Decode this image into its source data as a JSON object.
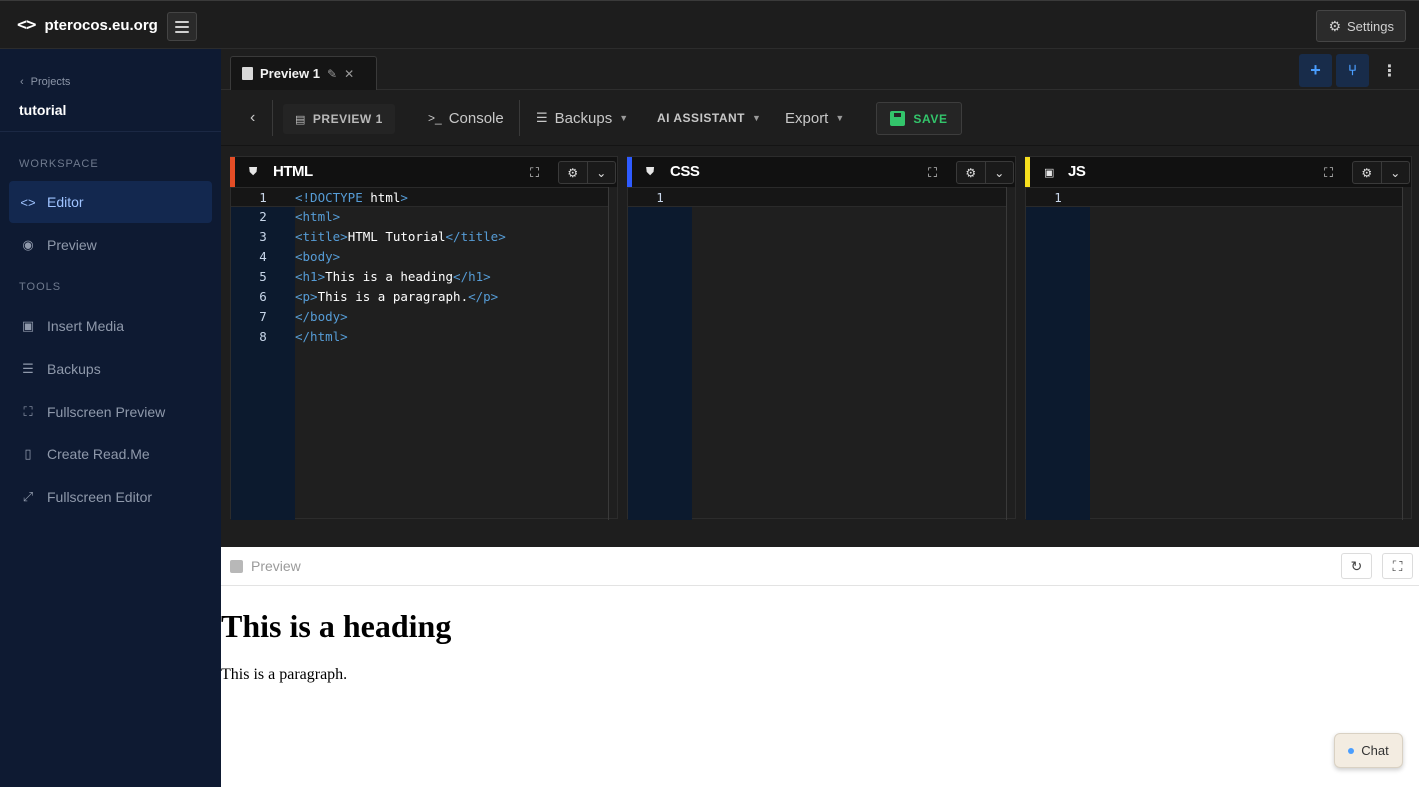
{
  "brand": {
    "name": "pterocos.eu.org",
    "icon": "code-icon"
  },
  "header": {
    "settings_label": "Settings"
  },
  "sidebar": {
    "breadcrumb": "Projects",
    "project_name": "tutorial",
    "sections": {
      "workspace": "WORKSPACE",
      "tools": "TOOLS"
    },
    "workspace_items": [
      {
        "label": "Editor",
        "icon": "code-icon",
        "active": true
      },
      {
        "label": "Preview",
        "icon": "eye-icon",
        "active": false
      }
    ],
    "tool_items": [
      {
        "label": "Insert Media",
        "icon": "image-icon"
      },
      {
        "label": "Backups",
        "icon": "database-icon"
      },
      {
        "label": "Fullscreen Preview",
        "icon": "fullscreen-icon"
      },
      {
        "label": "Create Read.Me",
        "icon": "book-icon"
      },
      {
        "label": "Fullscreen Editor",
        "icon": "expand-icon"
      }
    ]
  },
  "tabs": [
    {
      "label": "Preview 1",
      "active": true
    }
  ],
  "toolbar": {
    "preview_label": "PREVIEW 1",
    "console_label": "Console",
    "backups_label": "Backups",
    "ai_label": "AI ASSISTANT",
    "export_label": "Export",
    "save_label": "SAVE"
  },
  "panels": [
    {
      "title": "HTML",
      "accent": "#e44d26",
      "lines": [
        {
          "n": "1",
          "parts": [
            [
              "tag",
              "<!DOCTYPE "
            ],
            [
              "tx",
              "html"
            ],
            [
              "tag",
              ">"
            ]
          ]
        },
        {
          "n": "2",
          "parts": [
            [
              "tag",
              "<html>"
            ]
          ]
        },
        {
          "n": "3",
          "parts": [
            [
              "tag",
              "<title>"
            ],
            [
              "tx",
              "HTML Tutorial"
            ],
            [
              "tag",
              "</title>"
            ]
          ]
        },
        {
          "n": "4",
          "parts": [
            [
              "tag",
              "<body>"
            ]
          ]
        },
        {
          "n": "5",
          "parts": [
            [
              "tag",
              "<h1>"
            ],
            [
              "tx",
              "This is a heading"
            ],
            [
              "tag",
              "</h1>"
            ]
          ]
        },
        {
          "n": "6",
          "parts": [
            [
              "tag",
              "<p>"
            ],
            [
              "tx",
              "This is a paragraph."
            ],
            [
              "tag",
              "</p>"
            ]
          ]
        },
        {
          "n": "7",
          "parts": [
            [
              "tag",
              "</body>"
            ]
          ]
        },
        {
          "n": "8",
          "parts": [
            [
              "tag",
              "</html>"
            ]
          ]
        }
      ]
    },
    {
      "title": "CSS",
      "accent": "#2e5bff",
      "lines": [
        {
          "n": "1",
          "parts": []
        }
      ]
    },
    {
      "title": "JS",
      "accent": "#f7df1e",
      "lines": [
        {
          "n": "1",
          "parts": []
        }
      ]
    }
  ],
  "preview": {
    "label": "Preview",
    "heading": "This is a heading",
    "paragraph": "This is a paragraph."
  },
  "chat": {
    "label": "Chat"
  }
}
